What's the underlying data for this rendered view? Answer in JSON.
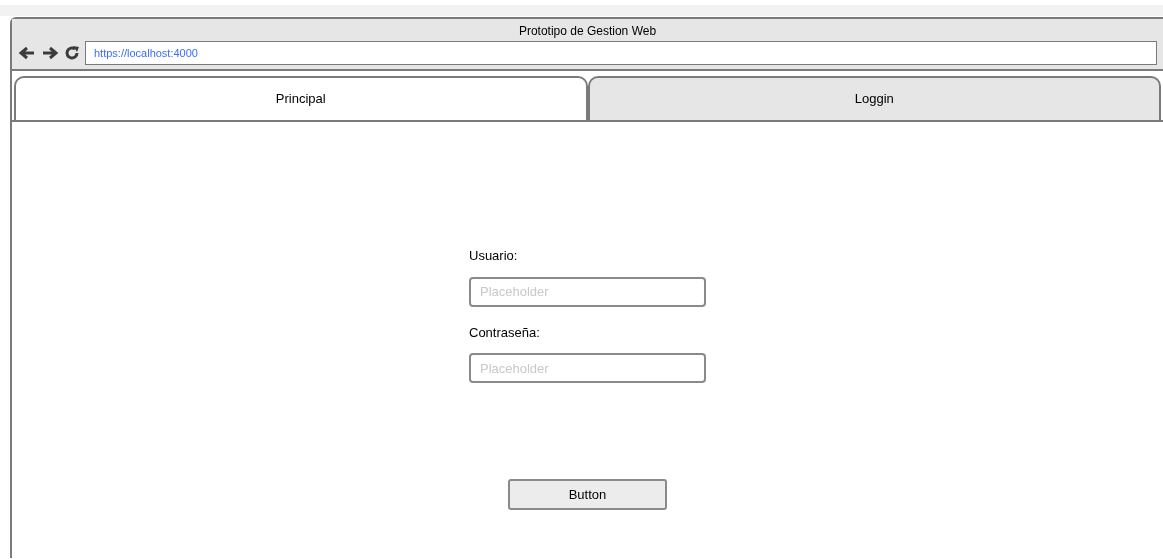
{
  "window": {
    "title": "Prototipo de Gestion Web"
  },
  "address_bar": {
    "url": "https://localhost:4000"
  },
  "tabs": [
    {
      "label": "Principal",
      "selected": true
    },
    {
      "label": "Loggin",
      "selected": false
    }
  ],
  "form": {
    "fields": [
      {
        "label": "Usuario:",
        "placeholder": "Placeholder"
      },
      {
        "label": "Contraseña:",
        "placeholder": "Placeholder"
      }
    ],
    "button": "Button"
  }
}
